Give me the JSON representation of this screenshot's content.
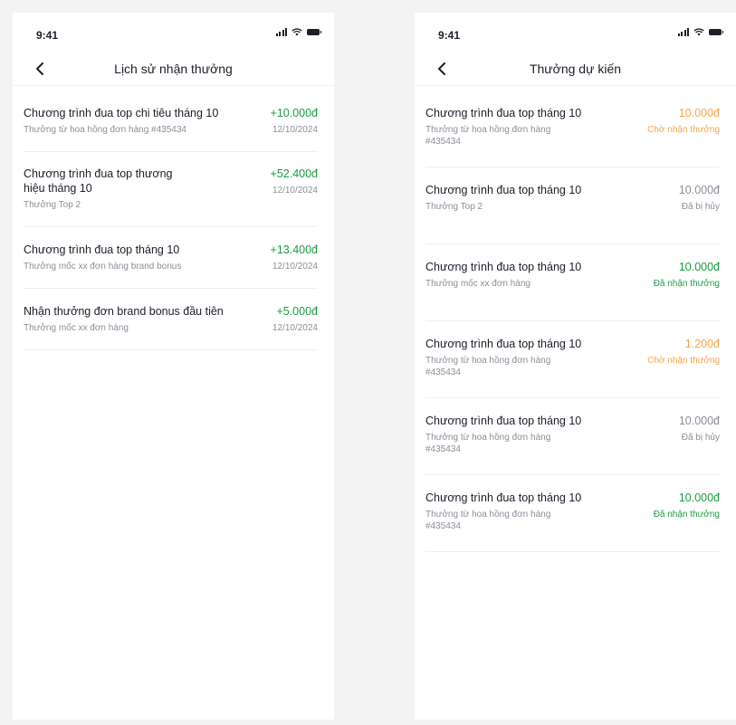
{
  "colors": {
    "green": "#1a9e3f",
    "orange": "#f5a54b",
    "gray": "#8a8f99",
    "text": "#1b1f2a"
  },
  "left": {
    "status_time": "9:41",
    "title": "Lịch sử nhận thưởng",
    "items": [
      {
        "title": "Chương trình đua top chi tiêu tháng 10",
        "sub": "Thưởng từ hoa hồng đơn hàng #435434",
        "amount": "+10.000đ",
        "date": "12/10/2024"
      },
      {
        "title": "Chương trình đua top thương hiệu tháng 10",
        "sub": "Thưởng Top 2",
        "amount": "+52.400đ",
        "date": "12/10/2024"
      },
      {
        "title": "Chương trình đua top tháng 10",
        "sub": "Thưởng mốc xx đơn hàng brand bonus",
        "amount": "+13.400đ",
        "date": "12/10/2024"
      },
      {
        "title": "Nhận thưởng đơn brand bonus đầu tiên",
        "sub": "Thưởng mốc xx đơn hàng",
        "amount": "+5.000đ",
        "date": "12/10/2024"
      }
    ]
  },
  "right": {
    "status_time": "9:41",
    "title": "Thưởng dự kiến",
    "items": [
      {
        "title": "Chương trình đua top tháng 10",
        "sub": "Thưởng từ hoa hồng đơn hàng #435434",
        "amount": "10.000đ",
        "status": "Chờ nhận thưởng",
        "state": "pending"
      },
      {
        "title": "Chương trình đua top tháng 10",
        "sub": "Thưởng Top 2",
        "amount": "10.000đ",
        "status": "Đã bị hủy",
        "state": "cancelled"
      },
      {
        "title": "Chương trình đua top tháng 10",
        "sub": "Thưởng mốc xx đơn hàng",
        "amount": "10.000đ",
        "status": "Đã nhận thưởng",
        "state": "received"
      },
      {
        "title": "Chương trình đua top tháng 10",
        "sub": "Thưởng từ hoa hồng đơn hàng #435434",
        "amount": "1.200đ",
        "status": "Chờ nhận thưởng",
        "state": "pending"
      },
      {
        "title": "Chương trình đua top tháng 10",
        "sub": "Thưởng từ hoa hồng đơn hàng #435434",
        "amount": "10.000đ",
        "status": "Đã bị hủy",
        "state": "cancelled"
      },
      {
        "title": "Chương trình đua top tháng 10",
        "sub": "Thưởng từ hoa hồng đơn hàng #435434",
        "amount": "10.000đ",
        "status": "Đã nhận thưởng",
        "state": "received"
      }
    ]
  }
}
